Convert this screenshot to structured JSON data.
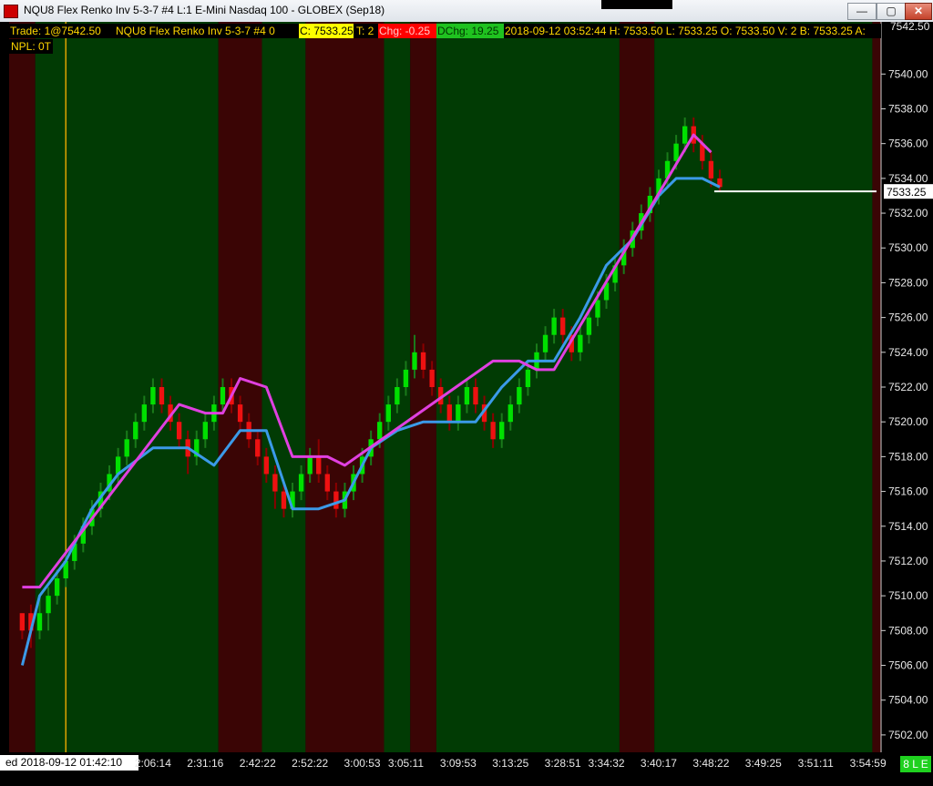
{
  "window": {
    "title": "NQU8  Flex Renko Inv 5-3-7  #4  L:1  E-Mini Nasdaq 100 - GLOBEX (Sep18)",
    "minimize": "—",
    "maximize": "▢",
    "close": "✕"
  },
  "infobar": {
    "trade": "Trade: 1@7542.50",
    "symbol": "NQU8  Flex Renko Inv 5-3-7  #4 0",
    "close": "C: 7533.25",
    "ticks": "T: 2",
    "chg": "Chg: -0.25",
    "dchg": "DChg: 19.25",
    "stats": "2018-09-12 03:52:44 H: 7533.50 L: 7533.25 O: 7533.50 V: 2 B: 7533.25 A:"
  },
  "npl": "NPL: 0T",
  "xaxis": {
    "start_label": "ed 2018-09-12  01:42:10",
    "badge": "8 L E"
  },
  "colors": {
    "up_candle": "#00e000",
    "up_wick": "#1a7a1a",
    "down_candle": "#ee1111",
    "bg_up": "#013b04",
    "bg_down": "#3a0505",
    "blue_line": "#3b9ae8",
    "magenta_line": "#e040e0",
    "price_marker": "#ffffff",
    "trade_line": "#ffb300"
  },
  "chart_data": {
    "type": "candlestick",
    "price_scale": {
      "min": 7501,
      "max": 7543,
      "ticks": [
        7502,
        7504,
        7506,
        7508,
        7510,
        7512,
        7514,
        7516,
        7518,
        7520,
        7522,
        7524,
        7526,
        7528,
        7530,
        7532,
        7534,
        7536,
        7538,
        7540
      ],
      "tick_label_format": "0.00",
      "top_label": "7542.50",
      "last_price_label": "7533.25",
      "last_price": 7533.25
    },
    "time_labels": [
      {
        "i": 16,
        "t": "2:06:14"
      },
      {
        "i": 22,
        "t": "2:31:16"
      },
      {
        "i": 28,
        "t": "2:42:22"
      },
      {
        "i": 34,
        "t": "2:52:22"
      },
      {
        "i": 40,
        "t": "3:00:53"
      },
      {
        "i": 45,
        "t": "3:05:11"
      },
      {
        "i": 51,
        "t": "3:09:53"
      },
      {
        "i": 57,
        "t": "3:13:25"
      },
      {
        "i": 63,
        "t": "3:28:51"
      },
      {
        "i": 68,
        "t": "3:34:32"
      },
      {
        "i": 74,
        "t": "3:40:17"
      },
      {
        "i": 80,
        "t": "3:48:22"
      },
      {
        "i": 86,
        "t": "3:49:25"
      },
      {
        "i": 92,
        "t": "3:51:11"
      },
      {
        "i": 98,
        "t": "3:54:59"
      }
    ],
    "trade_marker_bar": 6,
    "bar_count": 100,
    "background_zones": [
      {
        "from": 0,
        "to": 3,
        "trend": "down"
      },
      {
        "from": 3,
        "to": 24,
        "trend": "up"
      },
      {
        "from": 24,
        "to": 29,
        "trend": "down"
      },
      {
        "from": 29,
        "to": 34,
        "trend": "up"
      },
      {
        "from": 34,
        "to": 43,
        "trend": "down"
      },
      {
        "from": 43,
        "to": 46,
        "trend": "up"
      },
      {
        "from": 46,
        "to": 49,
        "trend": "down"
      },
      {
        "from": 49,
        "to": 70,
        "trend": "up"
      },
      {
        "from": 70,
        "to": 74,
        "trend": "down"
      },
      {
        "from": 74,
        "to": 99,
        "trend": "up"
      },
      {
        "from": 99,
        "to": 101,
        "trend": "down"
      }
    ],
    "candles": [
      {
        "i": 1,
        "o": 7508.0,
        "c": 7509.0,
        "h": 7509.0,
        "l": 7507.5,
        "d": "down"
      },
      {
        "i": 2,
        "o": 7509.0,
        "c": 7508.0,
        "h": 7509.5,
        "l": 7507.0,
        "d": "down"
      },
      {
        "i": 3,
        "o": 7508.0,
        "c": 7509.0,
        "h": 7510.0,
        "l": 7507.5,
        "d": "up"
      },
      {
        "i": 4,
        "o": 7509.0,
        "c": 7510.0,
        "h": 7510.5,
        "l": 7508.0,
        "d": "up"
      },
      {
        "i": 5,
        "o": 7510.0,
        "c": 7511.0,
        "h": 7511.5,
        "l": 7509.5,
        "d": "up"
      },
      {
        "i": 6,
        "o": 7511.0,
        "c": 7512.0,
        "h": 7512.5,
        "l": 7510.5,
        "d": "up"
      },
      {
        "i": 7,
        "o": 7512.0,
        "c": 7513.0,
        "h": 7513.5,
        "l": 7511.5,
        "d": "up"
      },
      {
        "i": 8,
        "o": 7513.0,
        "c": 7514.0,
        "h": 7514.5,
        "l": 7512.5,
        "d": "up"
      },
      {
        "i": 9,
        "o": 7514.0,
        "c": 7515.0,
        "h": 7515.5,
        "l": 7513.5,
        "d": "up"
      },
      {
        "i": 10,
        "o": 7515.0,
        "c": 7516.0,
        "h": 7516.5,
        "l": 7514.5,
        "d": "up"
      },
      {
        "i": 11,
        "o": 7516.0,
        "c": 7517.0,
        "h": 7517.5,
        "l": 7515.5,
        "d": "up"
      },
      {
        "i": 12,
        "o": 7517.0,
        "c": 7518.0,
        "h": 7518.5,
        "l": 7516.5,
        "d": "up"
      },
      {
        "i": 13,
        "o": 7518.0,
        "c": 7519.0,
        "h": 7519.5,
        "l": 7517.5,
        "d": "up"
      },
      {
        "i": 14,
        "o": 7519.0,
        "c": 7520.0,
        "h": 7520.5,
        "l": 7518.5,
        "d": "up"
      },
      {
        "i": 15,
        "o": 7520.0,
        "c": 7521.0,
        "h": 7521.5,
        "l": 7519.5,
        "d": "up"
      },
      {
        "i": 16,
        "o": 7521.0,
        "c": 7522.0,
        "h": 7522.5,
        "l": 7520.5,
        "d": "up"
      },
      {
        "i": 17,
        "o": 7522.0,
        "c": 7521.0,
        "h": 7522.5,
        "l": 7520.5,
        "d": "down"
      },
      {
        "i": 18,
        "o": 7521.0,
        "c": 7520.0,
        "h": 7521.5,
        "l": 7519.5,
        "d": "down"
      },
      {
        "i": 19,
        "o": 7520.0,
        "c": 7519.0,
        "h": 7520.5,
        "l": 7518.5,
        "d": "down"
      },
      {
        "i": 20,
        "o": 7519.0,
        "c": 7518.0,
        "h": 7519.5,
        "l": 7517.0,
        "d": "down"
      },
      {
        "i": 21,
        "o": 7518.0,
        "c": 7519.0,
        "h": 7519.5,
        "l": 7517.5,
        "d": "up"
      },
      {
        "i": 22,
        "o": 7519.0,
        "c": 7520.0,
        "h": 7520.5,
        "l": 7518.5,
        "d": "up"
      },
      {
        "i": 23,
        "o": 7520.0,
        "c": 7521.0,
        "h": 7521.5,
        "l": 7519.5,
        "d": "up"
      },
      {
        "i": 24,
        "o": 7521.0,
        "c": 7522.0,
        "h": 7522.5,
        "l": 7520.5,
        "d": "up"
      },
      {
        "i": 25,
        "o": 7522.0,
        "c": 7521.0,
        "h": 7522.5,
        "l": 7520.5,
        "d": "down"
      },
      {
        "i": 26,
        "o": 7521.0,
        "c": 7520.0,
        "h": 7521.5,
        "l": 7519.5,
        "d": "down"
      },
      {
        "i": 27,
        "o": 7520.0,
        "c": 7519.0,
        "h": 7520.5,
        "l": 7518.5,
        "d": "down"
      },
      {
        "i": 28,
        "o": 7519.0,
        "c": 7518.0,
        "h": 7519.5,
        "l": 7517.5,
        "d": "down"
      },
      {
        "i": 29,
        "o": 7518.0,
        "c": 7517.0,
        "h": 7518.5,
        "l": 7516.5,
        "d": "down"
      },
      {
        "i": 30,
        "o": 7517.0,
        "c": 7516.0,
        "h": 7517.5,
        "l": 7515.0,
        "d": "down"
      },
      {
        "i": 31,
        "o": 7516.0,
        "c": 7515.0,
        "h": 7516.5,
        "l": 7514.5,
        "d": "down"
      },
      {
        "i": 32,
        "o": 7515.0,
        "c": 7516.0,
        "h": 7516.5,
        "l": 7514.5,
        "d": "up"
      },
      {
        "i": 33,
        "o": 7516.0,
        "c": 7517.0,
        "h": 7517.5,
        "l": 7515.5,
        "d": "up"
      },
      {
        "i": 34,
        "o": 7517.0,
        "c": 7518.0,
        "h": 7518.5,
        "l": 7516.5,
        "d": "up"
      },
      {
        "i": 35,
        "o": 7518.0,
        "c": 7517.0,
        "h": 7519.0,
        "l": 7516.5,
        "d": "down"
      },
      {
        "i": 36,
        "o": 7517.0,
        "c": 7516.0,
        "h": 7517.5,
        "l": 7515.5,
        "d": "down"
      },
      {
        "i": 37,
        "o": 7516.0,
        "c": 7515.0,
        "h": 7516.5,
        "l": 7514.5,
        "d": "down"
      },
      {
        "i": 38,
        "o": 7515.0,
        "c": 7516.0,
        "h": 7516.5,
        "l": 7514.5,
        "d": "up"
      },
      {
        "i": 39,
        "o": 7516.0,
        "c": 7517.0,
        "h": 7517.5,
        "l": 7515.5,
        "d": "up"
      },
      {
        "i": 40,
        "o": 7517.0,
        "c": 7518.0,
        "h": 7518.5,
        "l": 7516.5,
        "d": "up"
      },
      {
        "i": 41,
        "o": 7518.0,
        "c": 7519.0,
        "h": 7519.5,
        "l": 7517.5,
        "d": "up"
      },
      {
        "i": 42,
        "o": 7519.0,
        "c": 7520.0,
        "h": 7520.5,
        "l": 7518.5,
        "d": "up"
      },
      {
        "i": 43,
        "o": 7520.0,
        "c": 7521.0,
        "h": 7521.5,
        "l": 7519.5,
        "d": "up"
      },
      {
        "i": 44,
        "o": 7521.0,
        "c": 7522.0,
        "h": 7522.5,
        "l": 7520.5,
        "d": "up"
      },
      {
        "i": 45,
        "o": 7522.0,
        "c": 7523.0,
        "h": 7523.5,
        "l": 7521.5,
        "d": "up"
      },
      {
        "i": 46,
        "o": 7523.0,
        "c": 7524.0,
        "h": 7525.0,
        "l": 7522.5,
        "d": "up"
      },
      {
        "i": 47,
        "o": 7524.0,
        "c": 7523.0,
        "h": 7524.5,
        "l": 7522.5,
        "d": "down"
      },
      {
        "i": 48,
        "o": 7523.0,
        "c": 7522.0,
        "h": 7523.5,
        "l": 7521.5,
        "d": "down"
      },
      {
        "i": 49,
        "o": 7522.0,
        "c": 7521.0,
        "h": 7522.5,
        "l": 7520.5,
        "d": "down"
      },
      {
        "i": 50,
        "o": 7521.0,
        "c": 7520.0,
        "h": 7521.5,
        "l": 7519.5,
        "d": "down"
      },
      {
        "i": 51,
        "o": 7520.0,
        "c": 7521.0,
        "h": 7521.5,
        "l": 7519.5,
        "d": "up"
      },
      {
        "i": 52,
        "o": 7521.0,
        "c": 7522.0,
        "h": 7522.5,
        "l": 7520.5,
        "d": "up"
      },
      {
        "i": 53,
        "o": 7522.0,
        "c": 7521.0,
        "h": 7522.5,
        "l": 7520.5,
        "d": "down"
      },
      {
        "i": 54,
        "o": 7521.0,
        "c": 7520.0,
        "h": 7521.5,
        "l": 7519.5,
        "d": "down"
      },
      {
        "i": 55,
        "o": 7520.0,
        "c": 7519.0,
        "h": 7520.5,
        "l": 7518.5,
        "d": "down"
      },
      {
        "i": 56,
        "o": 7519.0,
        "c": 7520.0,
        "h": 7520.5,
        "l": 7518.5,
        "d": "up"
      },
      {
        "i": 57,
        "o": 7520.0,
        "c": 7521.0,
        "h": 7521.5,
        "l": 7519.5,
        "d": "up"
      },
      {
        "i": 58,
        "o": 7521.0,
        "c": 7522.0,
        "h": 7522.5,
        "l": 7520.5,
        "d": "up"
      },
      {
        "i": 59,
        "o": 7522.0,
        "c": 7523.0,
        "h": 7523.5,
        "l": 7521.5,
        "d": "up"
      },
      {
        "i": 60,
        "o": 7523.0,
        "c": 7524.0,
        "h": 7524.5,
        "l": 7522.5,
        "d": "up"
      },
      {
        "i": 61,
        "o": 7524.0,
        "c": 7525.0,
        "h": 7525.5,
        "l": 7523.5,
        "d": "up"
      },
      {
        "i": 62,
        "o": 7525.0,
        "c": 7526.0,
        "h": 7526.5,
        "l": 7524.5,
        "d": "up"
      },
      {
        "i": 63,
        "o": 7526.0,
        "c": 7525.0,
        "h": 7526.5,
        "l": 7524.5,
        "d": "down"
      },
      {
        "i": 64,
        "o": 7525.0,
        "c": 7524.0,
        "h": 7525.5,
        "l": 7523.5,
        "d": "down"
      },
      {
        "i": 65,
        "o": 7524.0,
        "c": 7525.0,
        "h": 7525.5,
        "l": 7523.5,
        "d": "up"
      },
      {
        "i": 66,
        "o": 7525.0,
        "c": 7526.0,
        "h": 7526.5,
        "l": 7524.5,
        "d": "up"
      },
      {
        "i": 67,
        "o": 7526.0,
        "c": 7527.0,
        "h": 7527.5,
        "l": 7525.5,
        "d": "up"
      },
      {
        "i": 68,
        "o": 7527.0,
        "c": 7528.0,
        "h": 7528.5,
        "l": 7526.5,
        "d": "up"
      },
      {
        "i": 69,
        "o": 7528.0,
        "c": 7529.0,
        "h": 7529.5,
        "l": 7527.5,
        "d": "up"
      },
      {
        "i": 70,
        "o": 7529.0,
        "c": 7530.0,
        "h": 7530.5,
        "l": 7528.5,
        "d": "up"
      },
      {
        "i": 71,
        "o": 7530.0,
        "c": 7531.0,
        "h": 7531.5,
        "l": 7529.5,
        "d": "up"
      },
      {
        "i": 72,
        "o": 7531.0,
        "c": 7532.0,
        "h": 7532.5,
        "l": 7530.5,
        "d": "up"
      },
      {
        "i": 73,
        "o": 7532.0,
        "c": 7533.0,
        "h": 7533.5,
        "l": 7531.5,
        "d": "up"
      },
      {
        "i": 74,
        "o": 7533.0,
        "c": 7534.0,
        "h": 7534.5,
        "l": 7532.5,
        "d": "up"
      },
      {
        "i": 75,
        "o": 7534.0,
        "c": 7535.0,
        "h": 7535.5,
        "l": 7533.5,
        "d": "up"
      },
      {
        "i": 76,
        "o": 7535.0,
        "c": 7536.0,
        "h": 7536.5,
        "l": 7534.5,
        "d": "up"
      },
      {
        "i": 77,
        "o": 7536.0,
        "c": 7537.0,
        "h": 7537.5,
        "l": 7535.5,
        "d": "up"
      },
      {
        "i": 78,
        "o": 7537.0,
        "c": 7536.0,
        "h": 7537.5,
        "l": 7535.5,
        "d": "down"
      },
      {
        "i": 79,
        "o": 7536.0,
        "c": 7535.0,
        "h": 7536.5,
        "l": 7534.5,
        "d": "down"
      },
      {
        "i": 80,
        "o": 7535.0,
        "c": 7534.0,
        "h": 7535.5,
        "l": 7533.5,
        "d": "down"
      },
      {
        "i": 81,
        "o": 7534.0,
        "c": 7533.5,
        "h": 7534.5,
        "l": 7533.25,
        "d": "down"
      }
    ],
    "blue_line": [
      [
        1,
        7506
      ],
      [
        3,
        7510
      ],
      [
        6,
        7512
      ],
      [
        9,
        7515
      ],
      [
        12,
        7517
      ],
      [
        16,
        7518.5
      ],
      [
        20,
        7518.5
      ],
      [
        23,
        7517.5
      ],
      [
        26,
        7519.5
      ],
      [
        29,
        7519.5
      ],
      [
        32,
        7515
      ],
      [
        35,
        7515
      ],
      [
        38,
        7515.5
      ],
      [
        41,
        7518.5
      ],
      [
        44,
        7519.5
      ],
      [
        47,
        7520
      ],
      [
        50,
        7520
      ],
      [
        53,
        7520
      ],
      [
        56,
        7522
      ],
      [
        59,
        7523.5
      ],
      [
        62,
        7523.5
      ],
      [
        65,
        7526
      ],
      [
        68,
        7529
      ],
      [
        71,
        7530.5
      ],
      [
        74,
        7533
      ],
      [
        76,
        7534
      ],
      [
        79,
        7534
      ],
      [
        81,
        7533.5
      ]
    ],
    "magenta_line": [
      [
        1,
        7510.5
      ],
      [
        3,
        7510.5
      ],
      [
        19,
        7521
      ],
      [
        22,
        7520.5
      ],
      [
        24,
        7520.5
      ],
      [
        26,
        7522.5
      ],
      [
        29,
        7522
      ],
      [
        32,
        7518
      ],
      [
        35,
        7518
      ],
      [
        36,
        7518
      ],
      [
        38,
        7517.5
      ],
      [
        55,
        7523.5
      ],
      [
        58,
        7523.5
      ],
      [
        60,
        7523
      ],
      [
        62,
        7523
      ],
      [
        78,
        7536.5
      ],
      [
        80,
        7535.5
      ]
    ]
  }
}
